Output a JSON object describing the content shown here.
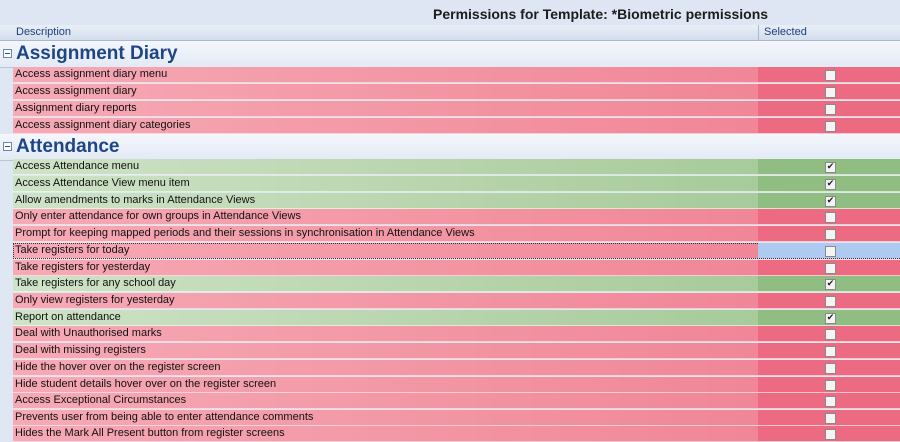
{
  "title": "Permissions for Template: *Biometric permissions",
  "columns": {
    "description": "Description",
    "selected": "Selected"
  },
  "groups": [
    {
      "name": "Assignment Diary",
      "rows": [
        {
          "label": "Access assignment diary menu",
          "checked": false
        },
        {
          "label": "Access assignment diary",
          "checked": false
        },
        {
          "label": "Assignment diary reports",
          "checked": false
        },
        {
          "label": "Access assignment diary categories",
          "checked": false
        }
      ]
    },
    {
      "name": "Attendance",
      "rows": [
        {
          "label": "Access Attendance menu",
          "checked": true
        },
        {
          "label": "Access Attendance View menu item",
          "checked": true
        },
        {
          "label": "Allow amendments to marks in Attendance Views",
          "checked": true
        },
        {
          "label": "Only enter attendance for own groups in Attendance Views",
          "checked": false
        },
        {
          "label": "Prompt for keeping mapped periods and their sessions in synchronisation in Attendance Views",
          "checked": false
        },
        {
          "label": "Take registers for today",
          "checked": false,
          "focused": true
        },
        {
          "label": "Take registers for yesterday",
          "checked": false
        },
        {
          "label": "Take registers for any school day",
          "checked": true
        },
        {
          "label": "Only view registers for yesterday",
          "checked": false
        },
        {
          "label": "Report on attendance",
          "checked": true
        },
        {
          "label": "Deal with Unauthorised marks",
          "checked": false
        },
        {
          "label": "Deal with missing registers",
          "checked": false
        },
        {
          "label": "Hide the hover over on the register screen",
          "checked": false
        },
        {
          "label": "Hide student details hover over on the register screen",
          "checked": false
        },
        {
          "label": "Access Exceptional Circumstances",
          "checked": false
        },
        {
          "label": "Prevents user from being able to enter attendance comments",
          "checked": false
        },
        {
          "label": "Hides the Mark All Present button from register screens",
          "checked": false
        }
      ]
    }
  ],
  "colors": {
    "unselected": "#ec6b82",
    "selected": "#8fbd82",
    "focused": "#aecaf0",
    "group_title": "#1e4585"
  }
}
